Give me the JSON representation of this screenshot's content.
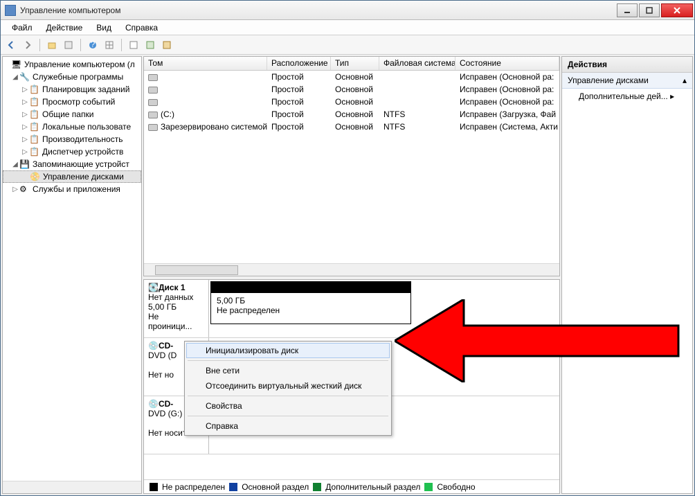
{
  "title": "Управление компьютером",
  "menu": {
    "file": "Файл",
    "action": "Действие",
    "view": "Вид",
    "help": "Справка"
  },
  "tree": {
    "root": "Управление компьютером (л",
    "sys": "Служебные программы",
    "sys_items": [
      "Планировщик заданий",
      "Просмотр событий",
      "Общие папки",
      "Локальные пользовате",
      "Производительность",
      "Диспетчер устройств"
    ],
    "storage": "Запоминающие устройст",
    "diskmgmt": "Управление дисками",
    "services": "Службы и приложения"
  },
  "cols": {
    "vol": "Том",
    "layout": "Расположение",
    "type": "Тип",
    "fs": "Файловая система",
    "status": "Состояние"
  },
  "rows": [
    {
      "vol": "",
      "layout": "Простой",
      "type": "Основной",
      "fs": "",
      "status": "Исправен (Основной ра:"
    },
    {
      "vol": "",
      "layout": "Простой",
      "type": "Основной",
      "fs": "",
      "status": "Исправен (Основной ра:"
    },
    {
      "vol": "",
      "layout": "Простой",
      "type": "Основной",
      "fs": "",
      "status": "Исправен (Основной ра:"
    },
    {
      "vol": "(C:)",
      "layout": "Простой",
      "type": "Основной",
      "fs": "NTFS",
      "status": "Исправен (Загрузка, Фай"
    },
    {
      "vol": "Зарезервировано системой",
      "layout": "Простой",
      "type": "Основной",
      "fs": "NTFS",
      "status": "Исправен (Система, Акти"
    }
  ],
  "disk1": {
    "name": "Диск 1",
    "nodata": "Нет данных",
    "size": "5,00 ГБ",
    "state": "Не проиници...",
    "vol_size": "5,00 ГБ",
    "vol_state": "Не распределен"
  },
  "cd1": {
    "name": "CD-",
    "dev": "DVD (D",
    "nomedia": "Нет но"
  },
  "cd2": {
    "name": "CD-",
    "dev": "DVD (G:)",
    "nomedia": "Нет носителя"
  },
  "legend": {
    "unalloc": "Не распределен",
    "primary": "Основной раздел",
    "ext": "Дополнительный раздел",
    "free": "Свободно"
  },
  "ctx": {
    "init": "Инициализировать диск",
    "offline": "Вне сети",
    "detach": "Отсоединить виртуальный жесткий диск",
    "props": "Свойства",
    "help": "Справка"
  },
  "actions": {
    "hdr": "Действия",
    "sub": "Управление дисками",
    "more": "Дополнительные дей..."
  }
}
